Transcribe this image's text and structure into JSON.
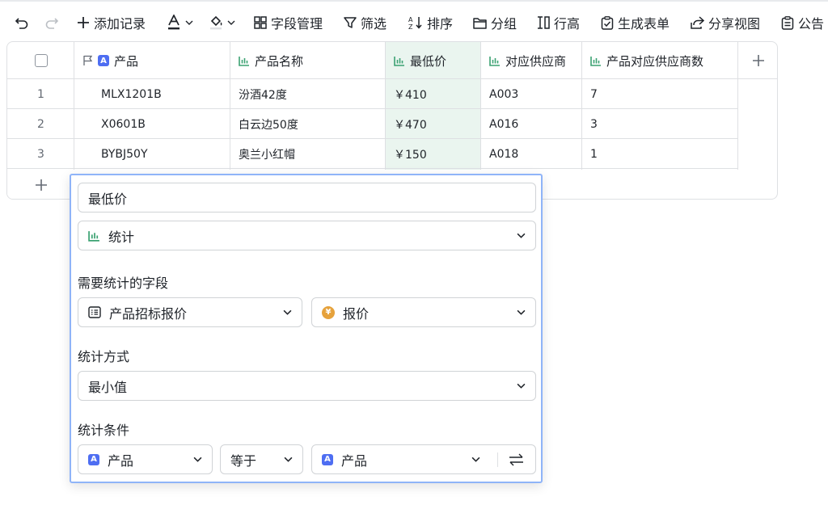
{
  "toolbar": {
    "add_record": "添加记录",
    "field_manage": "字段管理",
    "filter": "筛选",
    "sort": "排序",
    "group": "分组",
    "row_height": "行高",
    "gen_form": "生成表单",
    "share_view": "分享视图",
    "notice": "公告"
  },
  "table": {
    "columns": [
      {
        "label": "产品",
        "icon": "text-a-icon"
      },
      {
        "label": "产品名称",
        "icon": "stats-icon"
      },
      {
        "label": "最低价",
        "icon": "stats-icon"
      },
      {
        "label": "对应供应商",
        "icon": "stats-icon"
      },
      {
        "label": "产品对应供应商数",
        "icon": "stats-icon"
      }
    ],
    "rows": [
      {
        "num": "1",
        "product": "MLX1201B",
        "name": "汾酒42度",
        "min_price": "￥410",
        "supplier": "A003",
        "count": "7"
      },
      {
        "num": "2",
        "product": "X0601B",
        "name": "白云边50度",
        "min_price": "￥470",
        "supplier": "A016",
        "count": "3"
      },
      {
        "num": "3",
        "product": "BYBJ50Y",
        "name": "奥兰小红帽",
        "min_price": "￥150",
        "supplier": "A018",
        "count": "1"
      }
    ],
    "colors": {
      "highlight": "#eaf5ef",
      "stats_icon": "#3ba272",
      "badge": "#4e6ef2"
    }
  },
  "panel": {
    "field_name": "最低价",
    "field_type": "统计",
    "stat_field_label": "需要统计的字段",
    "stat_table": "产品招标报价",
    "stat_field": "报价",
    "method_label": "统计方式",
    "method": "最小值",
    "condition_label": "统计条件",
    "cond_left": "产品",
    "cond_op": "等于",
    "cond_right": "产品",
    "border_color": "#8fb4f8"
  }
}
